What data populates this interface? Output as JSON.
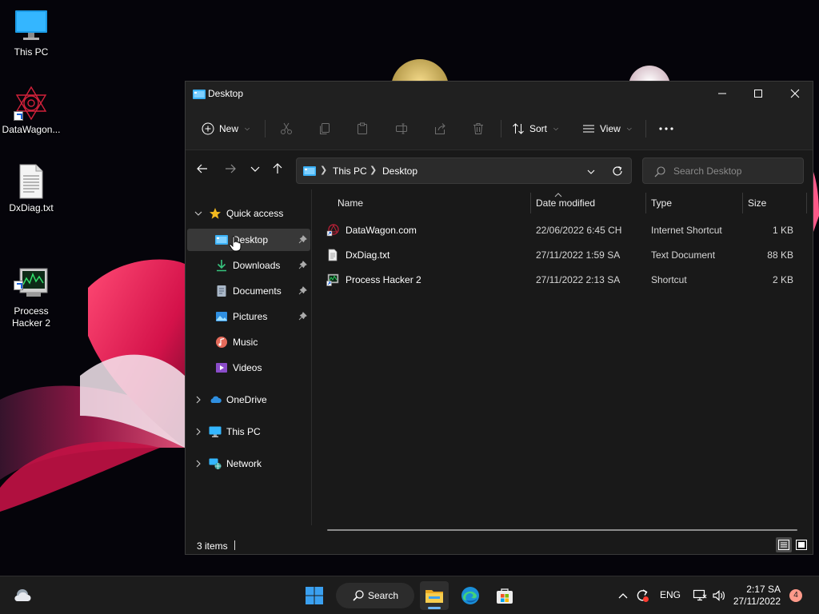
{
  "desktop": {
    "icons": [
      {
        "label": "This PC"
      },
      {
        "label": "DataWagon..."
      },
      {
        "label": "DxDiag.txt"
      },
      {
        "label": "Process\nHacker 2"
      }
    ]
  },
  "window": {
    "title": "Desktop",
    "commandbar": {
      "new_label": "New",
      "sort_label": "Sort",
      "view_label": "View"
    },
    "address": {
      "crumbs": [
        "This PC",
        "Desktop"
      ]
    },
    "search": {
      "placeholder": "Search Desktop"
    },
    "navpane": {
      "quick_access": "Quick access",
      "items": [
        {
          "label": "Desktop",
          "pinned": true,
          "selected": true
        },
        {
          "label": "Downloads",
          "pinned": true
        },
        {
          "label": "Documents",
          "pinned": true
        },
        {
          "label": "Pictures",
          "pinned": true
        },
        {
          "label": "Music"
        },
        {
          "label": "Videos"
        }
      ],
      "roots": [
        {
          "label": "OneDrive"
        },
        {
          "label": "This PC"
        },
        {
          "label": "Network"
        }
      ]
    },
    "columns": {
      "name": "Name",
      "date": "Date modified",
      "type": "Type",
      "size": "Size"
    },
    "files": [
      {
        "name": "DataWagon.com",
        "date": "22/06/2022 6:45 CH",
        "type": "Internet Shortcut",
        "size": "1 KB",
        "icon": "internet-shortcut-icon"
      },
      {
        "name": "DxDiag.txt",
        "date": "27/11/2022 1:59 SA",
        "type": "Text Document",
        "size": "88 KB",
        "icon": "text-document-icon"
      },
      {
        "name": "Process Hacker 2",
        "date": "27/11/2022 2:13 SA",
        "type": "Shortcut",
        "size": "2 KB",
        "icon": "process-hacker-icon"
      }
    ],
    "status": {
      "count": "3 items"
    }
  },
  "taskbar": {
    "search_label": "Search",
    "language": "ENG",
    "time": "2:17 SA",
    "date": "27/11/2022",
    "notifications": "4"
  },
  "colors": {
    "accent": "#60cdff",
    "folder": "#f3c84b",
    "window_bg": "#191919",
    "taskbar_bg": "#1c1c1c"
  }
}
